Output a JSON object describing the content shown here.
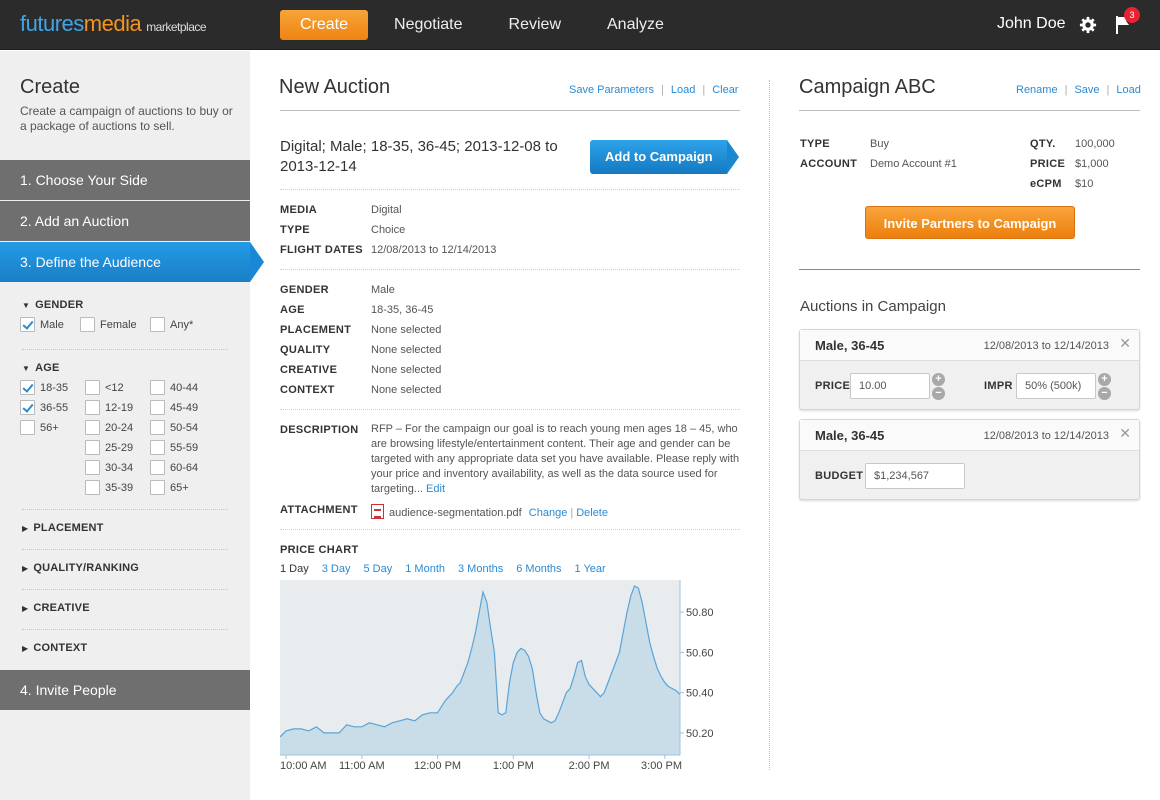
{
  "header": {
    "logo": {
      "part1": "futures",
      "part2": "media",
      "part3": "marketplace"
    },
    "nav": [
      "Create",
      "Negotiate",
      "Review",
      "Analyze"
    ],
    "user": "John Doe",
    "notification_count": "3"
  },
  "sidebar": {
    "title": "Create",
    "intro": "Create a campaign of auctions to buy or a package of auctions to sell.",
    "steps": [
      "1. Choose Your Side",
      "2. Add an Auction",
      "3. Define the Audience",
      "4. Invite People"
    ],
    "gender": {
      "label": "GENDER",
      "options": [
        {
          "label": "Male",
          "checked": true
        },
        {
          "label": "Female",
          "checked": false
        },
        {
          "label": "Any*",
          "checked": false
        }
      ]
    },
    "age": {
      "label": "AGE",
      "options": [
        {
          "label": "18-35",
          "checked": true
        },
        {
          "label": "36-55",
          "checked": true
        },
        {
          "label": "56+",
          "checked": false
        },
        {
          "label": "<12",
          "checked": false
        },
        {
          "label": "12-19",
          "checked": false
        },
        {
          "label": "20-24",
          "checked": false
        },
        {
          "label": "25-29",
          "checked": false
        },
        {
          "label": "30-34",
          "checked": false
        },
        {
          "label": "35-39",
          "checked": false
        },
        {
          "label": "40-44",
          "checked": false
        },
        {
          "label": "45-49",
          "checked": false
        },
        {
          "label": "50-54",
          "checked": false
        },
        {
          "label": "55-59",
          "checked": false
        },
        {
          "label": "60-64",
          "checked": false
        },
        {
          "label": "65+",
          "checked": false
        }
      ]
    },
    "collapsed": [
      "PLACEMENT",
      "QUALITY/RANKING",
      "CREATIVE",
      "CONTEXT"
    ]
  },
  "auction": {
    "title": "New Auction",
    "actions": [
      "Save Parameters",
      "Load",
      "Clear"
    ],
    "summary": "Digital; Male; 18-35, 36-45; 2013-12-08 to 2013-12-14",
    "add_button": "Add to Campaign",
    "fields1": [
      {
        "label": "MEDIA",
        "value": "Digital"
      },
      {
        "label": "TYPE",
        "value": "Choice"
      },
      {
        "label": "FLIGHT DATES",
        "value": "12/08/2013 to 12/14/2013"
      }
    ],
    "fields2": [
      {
        "label": "GENDER",
        "value": "Male"
      },
      {
        "label": "AGE",
        "value": "18-35, 36-45"
      },
      {
        "label": "PLACEMENT",
        "value": "None selected"
      },
      {
        "label": "QUALITY",
        "value": "None selected"
      },
      {
        "label": "CREATIVE",
        "value": "None selected"
      },
      {
        "label": "CONTEXT",
        "value": "None selected"
      }
    ],
    "description_label": "DESCRIPTION",
    "description": "RFP – For the campaign our goal is to reach young men ages 18 – 45, who are browsing lifestyle/entertainment content. Their age and gender can be targeted with any appropriate data set you have available. Please reply with your price and inventory availability, as well as the data source used for targeting...",
    "edit_link": "Edit",
    "attachment_label": "ATTACHMENT",
    "attachment_file": "audience-segmentation.pdf",
    "attachment_change": "Change",
    "attachment_delete": "Delete",
    "price_chart_label": "PRICE CHART",
    "ranges": [
      "1 Day",
      "3 Day",
      "5 Day",
      "1 Month",
      "3 Months",
      "6 Months",
      "1 Year"
    ],
    "active_range": "1 Day"
  },
  "chart_data": {
    "type": "area",
    "title": "",
    "xlabel": "",
    "ylabel": "",
    "x_ticks": [
      "10:00 AM",
      "11:00 AM",
      "12:00 PM",
      "1:00 PM",
      "2:00 PM",
      "3:00 PM"
    ],
    "y_ticks": [
      "50.80",
      "50.60",
      "50.40",
      "50.20"
    ],
    "ylim": [
      50.09,
      50.96
    ],
    "x_range": [
      9.92,
      15.2
    ],
    "axis_color": "#9fc3dd",
    "fill_color": "#c9dde9",
    "line_color": "#5aa3d6",
    "background": "#e8ecee",
    "series": [
      {
        "x": [
          9.92,
          10.0,
          10.1,
          10.2,
          10.3,
          10.4,
          10.5,
          10.6,
          10.7,
          10.8,
          10.9,
          11.0,
          11.1,
          11.2,
          11.3,
          11.4,
          11.5,
          11.6,
          11.7,
          11.8,
          11.9,
          12.0,
          12.05,
          12.1,
          12.15,
          12.2,
          12.25,
          12.3,
          12.35,
          12.4,
          12.45,
          12.5,
          12.55,
          12.6,
          12.65,
          12.7,
          12.75,
          12.8,
          12.85,
          12.9,
          12.95,
          13.0,
          13.05,
          13.1,
          13.15,
          13.2,
          13.25,
          13.3,
          13.35,
          13.4,
          13.45,
          13.5,
          13.55,
          13.6,
          13.65,
          13.7,
          13.75,
          13.8,
          13.85,
          13.9,
          13.95,
          14.0,
          14.05,
          14.1,
          14.15,
          14.2,
          14.25,
          14.3,
          14.35,
          14.4,
          14.45,
          14.5,
          14.55,
          14.6,
          14.65,
          14.7,
          14.75,
          14.8,
          14.85,
          14.9,
          14.95,
          15.0,
          15.05,
          15.1,
          15.15,
          15.2
        ],
        "y": [
          50.18,
          50.21,
          50.22,
          50.22,
          50.21,
          50.23,
          50.2,
          50.2,
          50.2,
          50.24,
          50.23,
          50.23,
          50.25,
          50.24,
          50.23,
          50.25,
          50.26,
          50.27,
          50.26,
          50.29,
          50.3,
          50.3,
          50.33,
          50.36,
          50.38,
          50.4,
          50.43,
          50.45,
          50.5,
          50.55,
          50.62,
          50.7,
          50.8,
          50.9,
          50.85,
          50.72,
          50.6,
          50.3,
          50.29,
          50.3,
          50.45,
          50.55,
          50.6,
          50.62,
          50.61,
          50.58,
          50.52,
          50.4,
          50.3,
          50.27,
          50.26,
          50.25,
          50.26,
          50.3,
          50.35,
          50.4,
          50.42,
          50.48,
          50.55,
          50.56,
          50.48,
          50.44,
          50.42,
          50.4,
          50.38,
          50.4,
          50.45,
          50.5,
          50.55,
          50.6,
          50.7,
          50.8,
          50.88,
          50.93,
          50.92,
          50.85,
          50.75,
          50.65,
          50.58,
          50.52,
          50.48,
          50.45,
          50.43,
          50.42,
          50.41,
          50.39
        ]
      }
    ]
  },
  "campaign": {
    "title": "Campaign ABC",
    "actions": [
      "Rename",
      "Save",
      "Load"
    ],
    "info_left": [
      {
        "label": "TYPE",
        "value": "Buy"
      },
      {
        "label": "ACCOUNT",
        "value": "Demo Account #1"
      }
    ],
    "info_right": [
      {
        "label": "QTY.",
        "value": "100,000"
      },
      {
        "label": "PRICE",
        "value": "$1,000"
      },
      {
        "label": "eCPM",
        "value": "$10"
      }
    ],
    "invite_button": "Invite Partners to Campaign",
    "auctions_title": "Auctions in Campaign",
    "cards": [
      {
        "title": "Male, 36-45",
        "date": "12/08/2013 to 12/14/2013",
        "price_label": "PRICE",
        "price_value": "10.00",
        "impr_label": "IMPR",
        "impr_value": "50% (500k)"
      },
      {
        "title": "Male, 36-45",
        "date": "12/08/2013 to 12/14/2013",
        "budget_label": "BUDGET",
        "budget_value": "$1,234,567"
      }
    ]
  }
}
